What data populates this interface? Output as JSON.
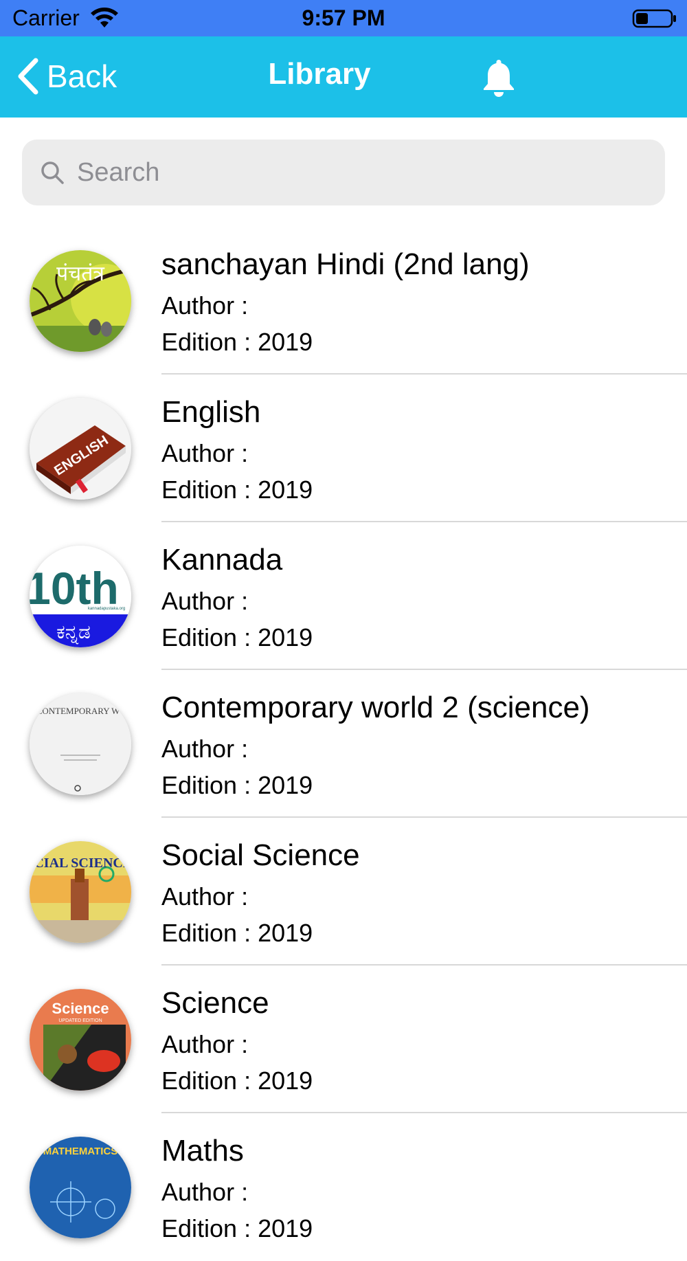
{
  "status_bar": {
    "carrier": "Carrier",
    "time": "9:57 PM",
    "icons": [
      "wifi-icon",
      "battery-icon"
    ]
  },
  "nav": {
    "back_label": "Back",
    "title": "Library",
    "right_icon": "bell-icon"
  },
  "search": {
    "placeholder": "Search",
    "value": ""
  },
  "books": [
    {
      "title": "sanchayan Hindi (2nd lang)",
      "author": "Author :",
      "edition": "Edition : 2019",
      "cover_text": "पंचतंत्र"
    },
    {
      "title": "English",
      "author": "Author :",
      "edition": "Edition : 2019",
      "cover_text": "ENGLISH"
    },
    {
      "title": "Kannada",
      "author": "Author :",
      "edition": "Edition : 2019",
      "cover_text": "10th",
      "cover_subtext": "ಕನ್ನಡ",
      "cover_small": "kannadapustaka.org"
    },
    {
      "title": "Contemporary world 2 (science)",
      "author": "Author :",
      "edition": "Edition : 2019",
      "cover_text": "THE CONTEMPORARY WORLD"
    },
    {
      "title": "Social Science",
      "author": "Author :",
      "edition": "Edition : 2019",
      "cover_text": "SOCIAL SCIENCES"
    },
    {
      "title": "Science",
      "author": "Author :",
      "edition": "Edition : 2019",
      "cover_text": "Science",
      "cover_small": "UPDATED EDITION"
    },
    {
      "title": "Maths",
      "author": "Author :",
      "edition": "Edition : 2019",
      "cover_text": "MATHEMATICS"
    }
  ],
  "colors": {
    "status_bar": "#3f7ff5",
    "nav_bar": "#1cc0e8",
    "search_bg": "#ececec",
    "divider": "#d8d8d8"
  }
}
